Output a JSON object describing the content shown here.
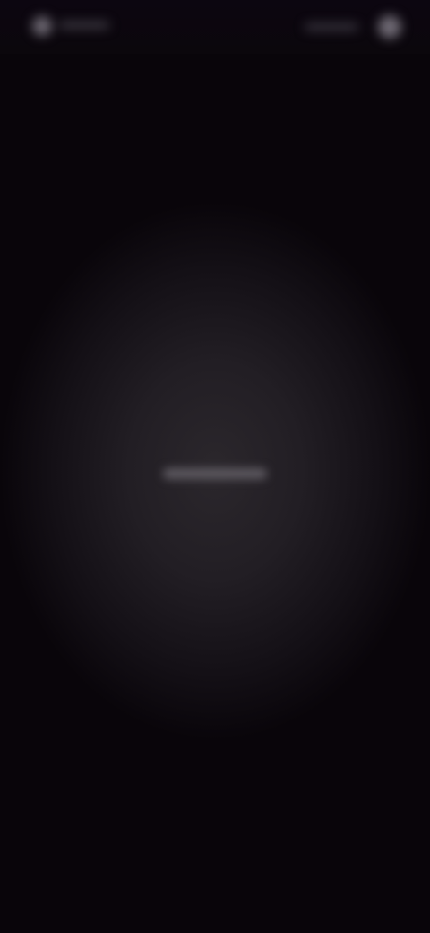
{
  "screen": {
    "state": "blurred-loading",
    "colors": {
      "background": "#09050a",
      "center_glow": "#2b272c",
      "placeholder_text": "#b9b5bb"
    }
  },
  "top_bar": {
    "left_icon": "avatar-icon",
    "right_icon": "profile-icon"
  },
  "center": {
    "label": ""
  }
}
